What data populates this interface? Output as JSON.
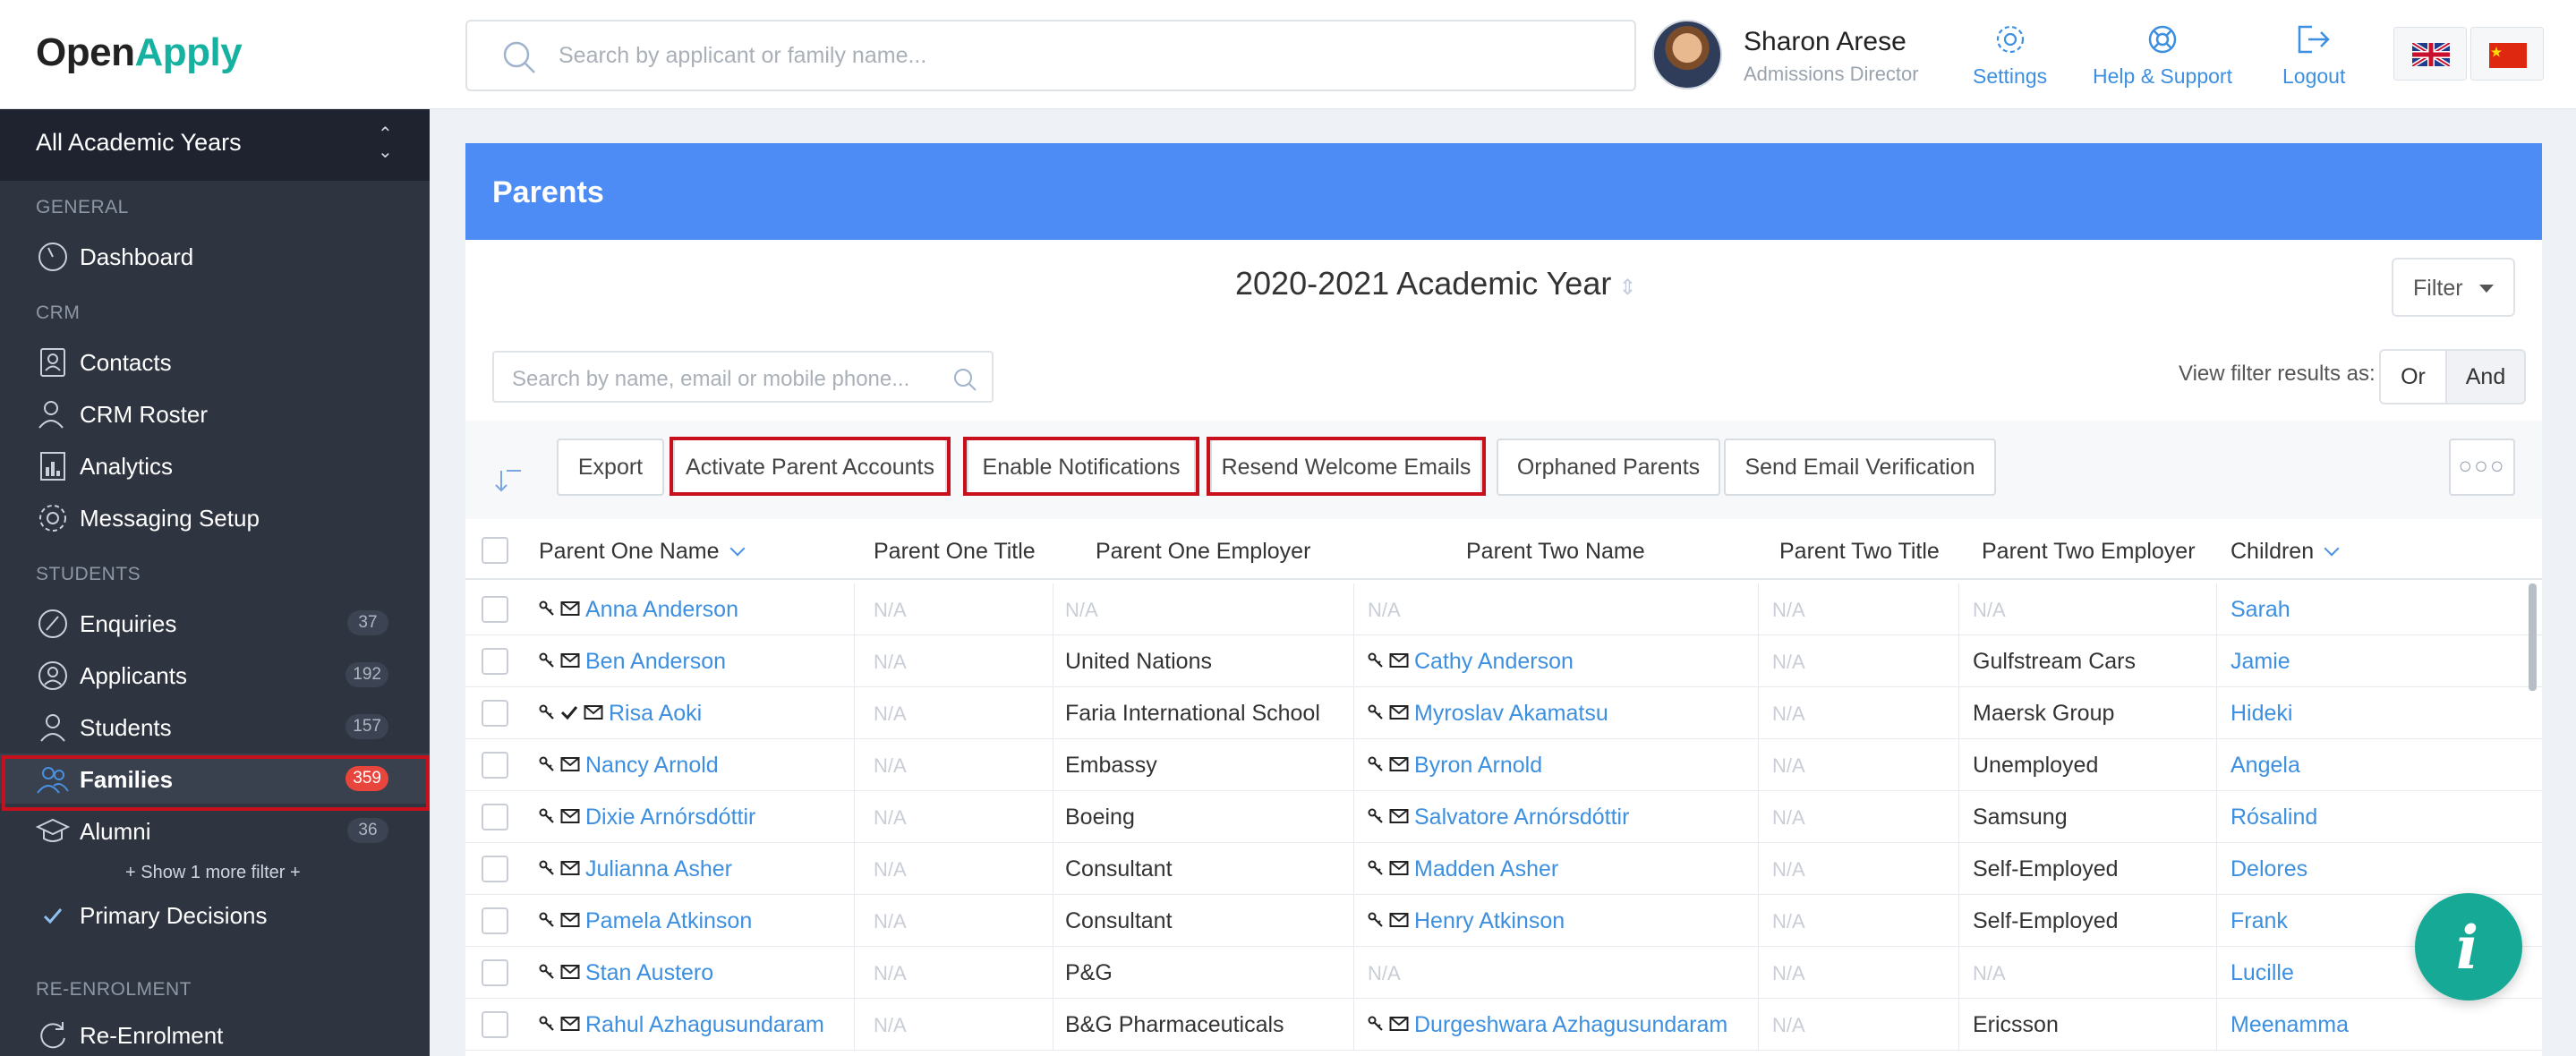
{
  "brand": {
    "part1": "Open",
    "part2": "Apply"
  },
  "topbar": {
    "search_placeholder": "Search by applicant or family name...",
    "user_name": "Sharon Arese",
    "user_role": "Admissions Director",
    "nav": {
      "settings": "Settings",
      "help": "Help & Support",
      "logout": "Logout"
    }
  },
  "sidebar": {
    "year_selector": "All Academic Years",
    "sections": {
      "general": "GENERAL",
      "crm": "CRM",
      "students": "STUDENTS",
      "reenrol": "RE-ENROLMENT"
    },
    "items": {
      "dashboard": {
        "label": "Dashboard"
      },
      "contacts": {
        "label": "Contacts"
      },
      "crm_roster": {
        "label": "CRM Roster"
      },
      "analytics": {
        "label": "Analytics"
      },
      "messaging": {
        "label": "Messaging Setup"
      },
      "enquiries": {
        "label": "Enquiries",
        "count": "37"
      },
      "applicants": {
        "label": "Applicants",
        "count": "192"
      },
      "students": {
        "label": "Students",
        "count": "157"
      },
      "families": {
        "label": "Families",
        "count": "359"
      },
      "alumni": {
        "label": "Alumni",
        "count": "36"
      },
      "primary": {
        "label": "Primary Decisions"
      },
      "reenrolment": {
        "label": "Re-Enrolment"
      }
    },
    "more_filter": "+ Show 1 more filter +"
  },
  "panel": {
    "title": "Parents",
    "academic_year": "2020-2021 Academic Year",
    "filter_label": "Filter",
    "table_search_placeholder": "Search by name, email or mobile phone...",
    "view_filter_label": "View filter results as:",
    "seg_or": "Or",
    "seg_and": "And",
    "toolbar": {
      "export": "Export",
      "activate": "Activate Parent Accounts",
      "enable_notif": "Enable Notifications",
      "resend": "Resend Welcome Emails",
      "orphaned": "Orphaned Parents",
      "send_verif": "Send Email Verification",
      "more": "○○○"
    }
  },
  "table": {
    "headers": {
      "p1_name": "Parent One Name",
      "p1_title": "Parent One Title",
      "p1_employer": "Parent One Employer",
      "p2_name": "Parent Two Name",
      "p2_title": "Parent Two Title",
      "p2_employer": "Parent Two Employer",
      "children": "Children"
    },
    "na": "N/A",
    "rows": [
      {
        "p1": "Anna Anderson",
        "p1_check": false,
        "p1_title": "N/A",
        "p1_emp": "N/A",
        "p2": "N/A",
        "p2_title": "N/A",
        "p2_emp": "N/A",
        "child": "Sarah"
      },
      {
        "p1": "Ben Anderson",
        "p1_check": false,
        "p1_title": "N/A",
        "p1_emp": "United Nations",
        "p2": "Cathy Anderson",
        "p2_title": "N/A",
        "p2_emp": "Gulfstream Cars",
        "child": "Jamie"
      },
      {
        "p1": "Risa Aoki",
        "p1_check": true,
        "p1_title": "N/A",
        "p1_emp": "Faria International School",
        "p2": "Myroslav Akamatsu",
        "p2_title": "N/A",
        "p2_emp": "Maersk Group",
        "child": "Hideki"
      },
      {
        "p1": "Nancy Arnold",
        "p1_check": false,
        "p1_title": "N/A",
        "p1_emp": "Embassy",
        "p2": "Byron Arnold",
        "p2_title": "N/A",
        "p2_emp": "Unemployed",
        "child": "Angela"
      },
      {
        "p1": "Dixie Arnórsdóttir",
        "p1_check": false,
        "p1_title": "N/A",
        "p1_emp": "Boeing",
        "p2": "Salvatore Arnórsdóttir",
        "p2_title": "N/A",
        "p2_emp": "Samsung",
        "child": "Rósalind"
      },
      {
        "p1": "Julianna Asher",
        "p1_check": false,
        "p1_title": "N/A",
        "p1_emp": "Consultant",
        "p2": "Madden Asher",
        "p2_title": "N/A",
        "p2_emp": "Self-Employed",
        "child": "Delores"
      },
      {
        "p1": "Pamela Atkinson",
        "p1_check": false,
        "p1_title": "N/A",
        "p1_emp": "Consultant",
        "p2": "Henry Atkinson",
        "p2_title": "N/A",
        "p2_emp": "Self-Employed",
        "child": "Frank"
      },
      {
        "p1": "Stan Austero",
        "p1_check": false,
        "p1_title": "N/A",
        "p1_emp": "P&G",
        "p2": "N/A",
        "p2_title": "N/A",
        "p2_emp": "N/A",
        "child": "Lucille"
      },
      {
        "p1": "Rahul Azhagusundaram",
        "p1_check": false,
        "p1_title": "N/A",
        "p1_emp": "B&G Pharmaceuticals",
        "p2": "Durgeshwara Azhagusundaram",
        "p2_title": "N/A",
        "p2_emp": "Ericsson",
        "child": "Meenamma"
      }
    ]
  },
  "fab_label": "i",
  "colors": {
    "brand_teal": "#16b1a0",
    "header_blue": "#4d8cf5",
    "link_blue": "#3d8fe0",
    "highlight_red": "#c8101d",
    "sidebar_bg": "#2e3440"
  }
}
